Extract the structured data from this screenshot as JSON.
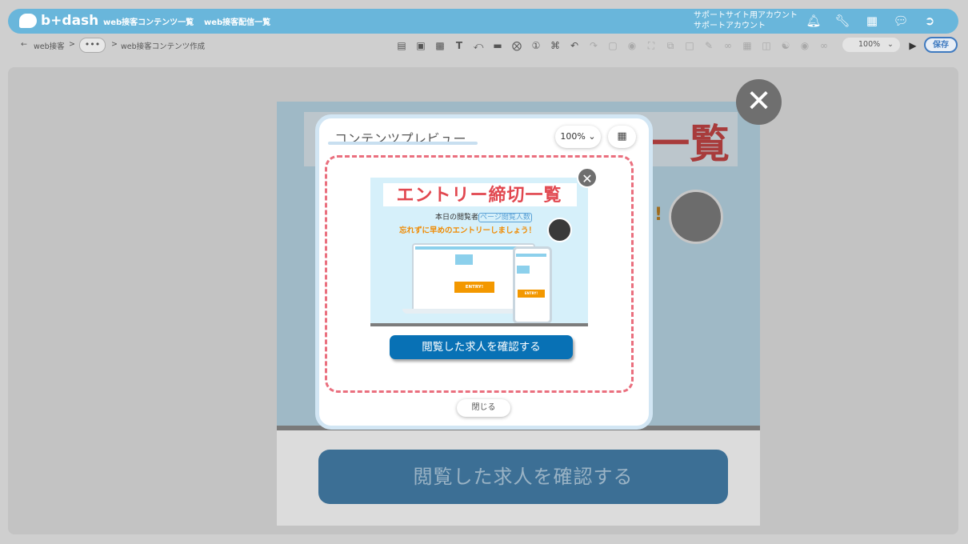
{
  "app": {
    "logo_text": "b+dash"
  },
  "nav": {
    "links": [
      "web接客コンテンツ一覧",
      "web接客配信一覧"
    ]
  },
  "account": {
    "line1": "サポートサイト用アカウント",
    "line2": "サポートアカウント"
  },
  "header_icons": [
    "bell-icon",
    "wrench-icon",
    "apps-grid-icon",
    "chat-bubble-icon",
    "logout-icon"
  ],
  "breadcrumb": {
    "back_arrow": "←",
    "root": "web接客",
    "sep": ">",
    "more": "•••",
    "current": "web接客コンテンツ作成"
  },
  "toolbar": {
    "tools": [
      "list-icon",
      "image-icon",
      "video-icon",
      "text-icon",
      "line-icon",
      "badge-icon",
      "close-circle-icon",
      "number-icon",
      "crop-icon",
      "undo-icon",
      "redo-icon",
      "frame-icon",
      "drop-icon",
      "expand-icon",
      "layers-icon",
      "square-icon",
      "edit-icon",
      "link-icon",
      "calendar-icon",
      "table-icon",
      "database-icon",
      "group-icon",
      "chain-icon"
    ],
    "zoom": "100%",
    "save_label": "保存"
  },
  "background": {
    "title_fragment": "一覧",
    "cta_label": "閲覧した求人を確認する",
    "exclamation": "!"
  },
  "modal": {
    "title": "コンテンツプレビュー",
    "zoom": "100%",
    "close_label": "閉じる",
    "popup": {
      "title": "エントリー締切一覧",
      "viewers_prefix": "本日の閲覧者",
      "viewers_tag": "ページ閲覧人数",
      "reminder": "忘れずに早めのエントリーしましょう！",
      "laptop_button": "ENTRY!",
      "phone_button": "ENTRY!",
      "cta_label": "閲覧した求人を確認する"
    }
  }
}
